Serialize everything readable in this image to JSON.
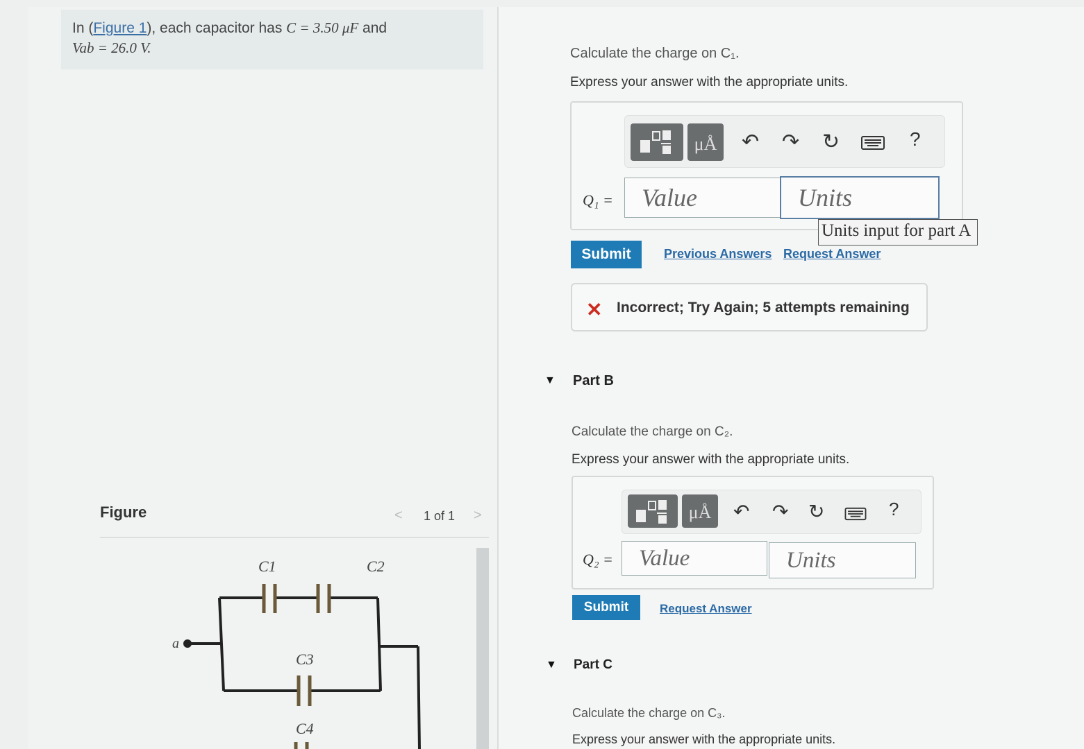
{
  "problem": {
    "text_prefix": "In (",
    "figure_link": "Figure 1",
    "text_mid": "), each capacitor has ",
    "c_expr": "C = 3.50 μF",
    "text_and": " and",
    "v_expr": "Vab = 26.0 V."
  },
  "figure": {
    "heading": "Figure",
    "pager": "1 of 1",
    "labels": {
      "c1": "C1",
      "c2": "C2",
      "c3": "C3",
      "c4": "C4",
      "node_a": "a"
    }
  },
  "partA": {
    "prompt": "Calculate the charge on C₁.",
    "instruction": "Express your answer with the appropriate units.",
    "variable": "Q₁ =",
    "value_placeholder": "Value",
    "units_placeholder": "Units",
    "tooltip": "Units input for part A",
    "submit": "Submit",
    "links": [
      "Previous Answers",
      "Request Answer"
    ],
    "feedback": "Incorrect; Try Again; 5 attempts remaining"
  },
  "partB": {
    "label": "Part B",
    "prompt": "Calculate the charge on C₂.",
    "instruction": "Express your answer with the appropriate units.",
    "variable": "Q₂ =",
    "value_placeholder": "Value",
    "units_placeholder": "Units",
    "submit": "Submit",
    "links": [
      "Request Answer"
    ]
  },
  "partC": {
    "label": "Part C",
    "prompt": "Calculate the charge on C₃.",
    "instruction": "Express your answer with the appropriate units."
  },
  "toolbar": {
    "units_symbol": "μÅ",
    "help": "?",
    "icons": [
      "templates-icon",
      "units-icon",
      "undo-icon",
      "redo-icon",
      "reset-icon",
      "keyboard-icon",
      "help-icon"
    ]
  },
  "colors": {
    "submit": "#1f7bb5",
    "link": "#2a6aa6",
    "error": "#cc2c20"
  }
}
